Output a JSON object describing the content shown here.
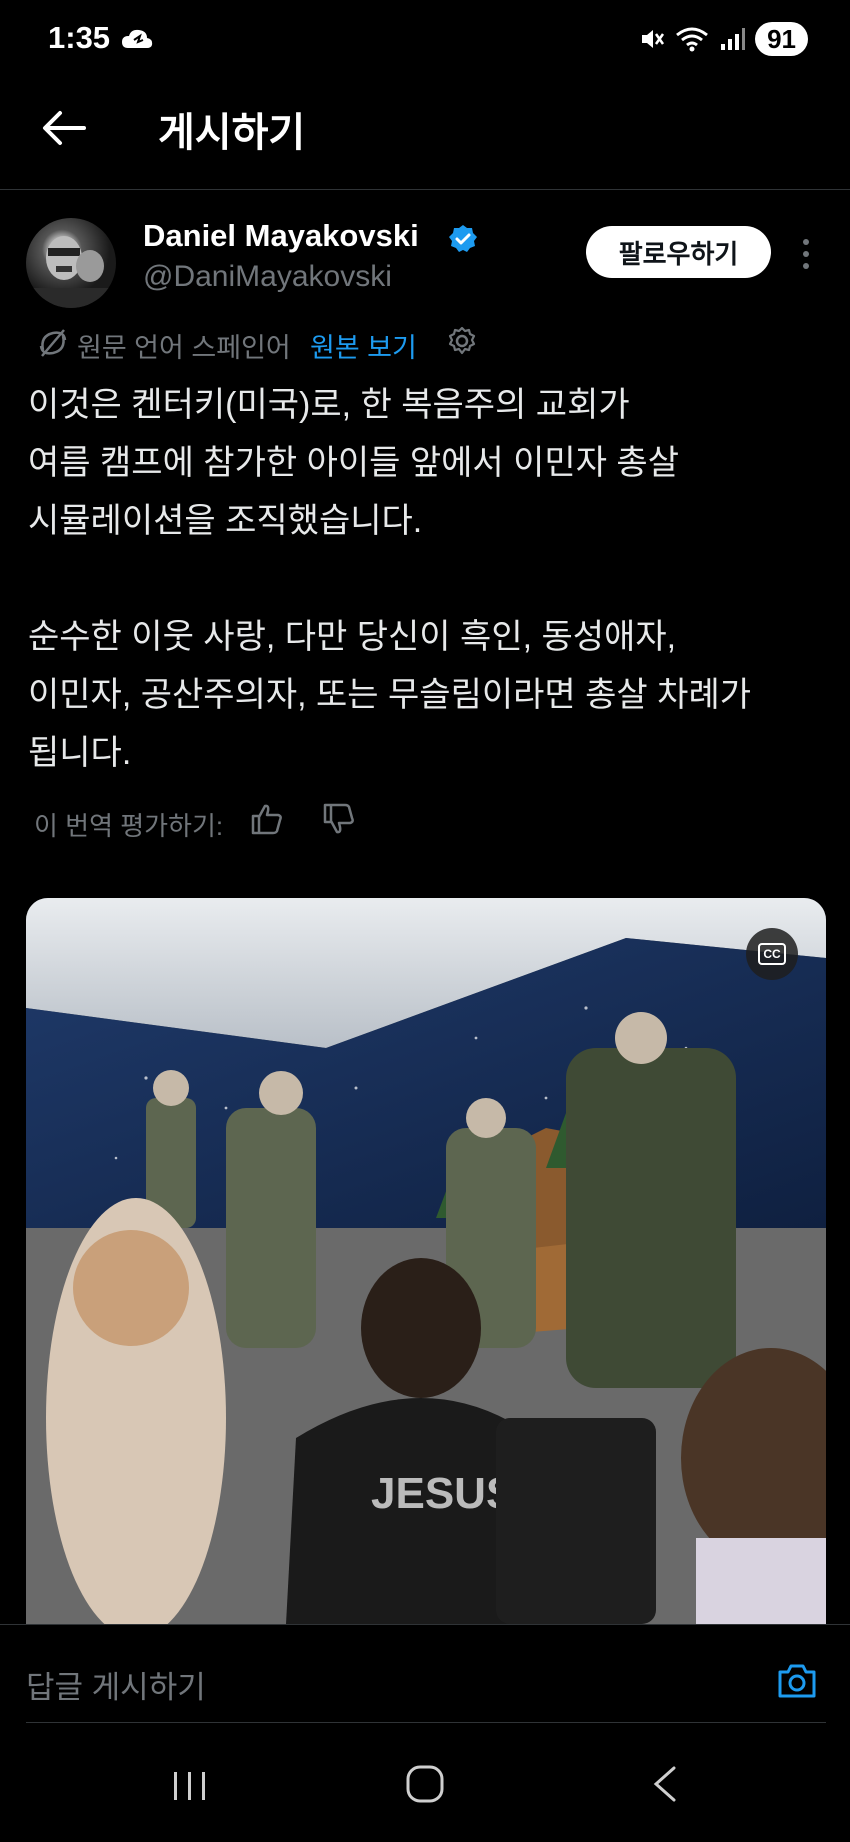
{
  "status_bar": {
    "time": "1:35",
    "battery": "91"
  },
  "header": {
    "title": "게시하기"
  },
  "author": {
    "name": "Daniel Mayakovski",
    "handle": "@DaniMayakovski",
    "follow_label": "팔로우하기"
  },
  "translation": {
    "label": "원문 언어 스페인어",
    "show_original": "원본 보기"
  },
  "post": {
    "text": "이것은 켄터키(미국)로, 한 복음주의 교회가\n여름 캠프에 참가한 아이들 앞에서 이민자 총살\n시뮬레이션을 조직했습니다.\n\n순수한 이웃 사랑, 다만 당신이 흑인, 동성애자,\n이민자, 공산주의자, 또는 무슬림이라면 총살 차례가\n됩니다."
  },
  "rate": {
    "label": "이 번역 평가하기:"
  },
  "media": {
    "cc_label": "CC",
    "shirt_text": "JESUS"
  },
  "reply": {
    "placeholder": "답글 게시하기"
  },
  "colors": {
    "accent": "#1d9bf0",
    "background": "#000000",
    "muted": "#71767b"
  },
  "icons": [
    "back-arrow-icon",
    "verified-badge-icon",
    "more-vertical-icon",
    "translate-icon",
    "gear-icon",
    "thumb-up-icon",
    "thumb-down-icon",
    "closed-captions-icon",
    "camera-icon",
    "recent-apps-icon",
    "home-icon",
    "nav-back-icon"
  ]
}
